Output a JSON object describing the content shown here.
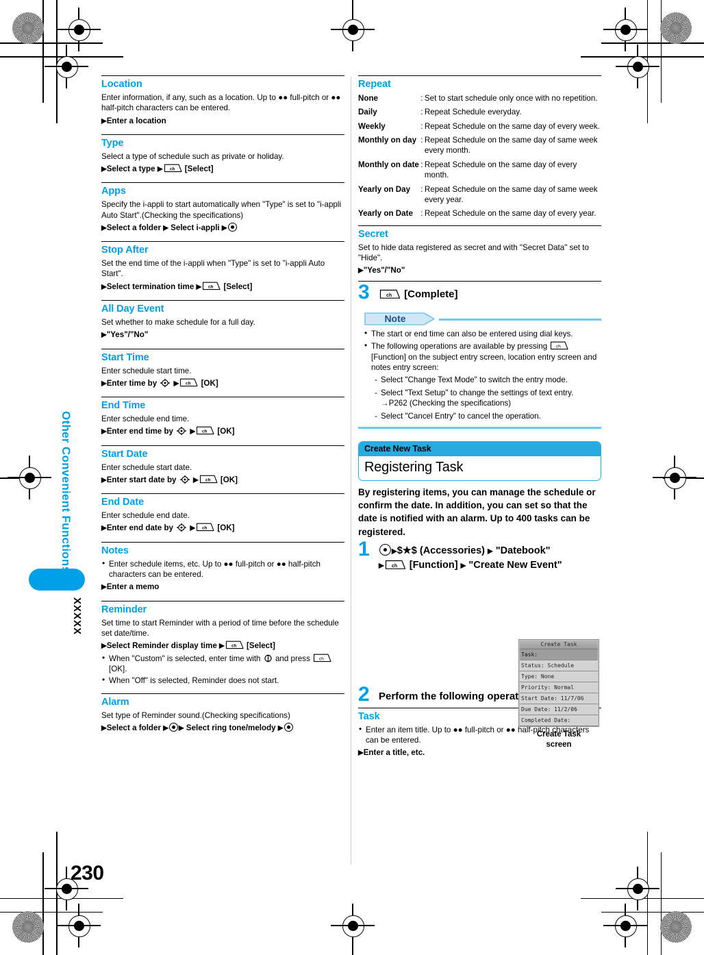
{
  "page": {
    "number": "230",
    "side_title": "Other Convenient Functions",
    "side_marker": "XXXXX"
  },
  "left_column": {
    "sections": [
      {
        "heading": "Location",
        "body": "Enter information, if any, such as a location. Up to ●● full-pitch or ●● half-pitch characters can be entered.",
        "operation": "Enter a location"
      },
      {
        "heading": "Type",
        "body": "Select a type of schedule such as private or holiday.",
        "operation": "Select a type",
        "operation_tail": "[Select]"
      },
      {
        "heading": "Apps",
        "body": "Specify the i-appli to start automatically when \"Type\" is set to \"i-appli Auto Start\".(Checking the specifications)",
        "operation": "Select a folder",
        "operation_mid": "Select i-appli"
      },
      {
        "heading": "Stop After",
        "body": "Set the end time of the i-appli when \"Type\" is set to \"i-appli Auto Start\".",
        "operation": "Select termination time",
        "operation_tail": "[Select]"
      },
      {
        "heading": "All Day Event",
        "body": "Set whether to make schedule for a full day.",
        "operation": "\"Yes\"/\"No\""
      },
      {
        "heading": "Start Time",
        "body": "Enter schedule start time.",
        "operation": "Enter time by",
        "operation_tail": "[OK]"
      },
      {
        "heading": "End Time",
        "body": "Enter schedule end time.",
        "operation": "Enter end time by",
        "operation_tail": "[OK]"
      },
      {
        "heading": "Start Date",
        "body": "Enter schedule start date.",
        "operation": "Enter start date by",
        "operation_tail": "[OK]"
      },
      {
        "heading": "End Date",
        "body": "Enter schedule end date.",
        "operation": "Enter end date by",
        "operation_tail": "[OK]"
      },
      {
        "heading": "Notes",
        "bullet": "Enter schedule items, etc. Up to ●● full-pitch or ●● half-pitch characters can be entered.",
        "operation": "Enter a memo"
      },
      {
        "heading": "Reminder",
        "body": "Set time to start Reminder with a period of time before the schedule set date/time.",
        "operation": "Select Reminder display time",
        "operation_tail": "[Select]",
        "bullet1_a": "When \"Custom\" is selected, enter time with",
        "bullet1_b": "and press",
        "bullet1_c": "[OK].",
        "bullet2": "When \"Off\" is selected, Reminder does not start."
      },
      {
        "heading": "Alarm",
        "body": "Set type of Reminder sound.(Checking specifications)",
        "operation": "Select a folder",
        "operation_mid": "Select ring tone/melody"
      }
    ]
  },
  "right_column": {
    "repeat": {
      "heading": "Repeat",
      "rows": [
        {
          "term": "None",
          "colon": ":",
          "desc": "Set to start schedule only once with no repetition."
        },
        {
          "term": "Daily",
          "colon": ":",
          "desc": "Repeat Schedule everyday."
        },
        {
          "term": "Weekly",
          "colon": ":",
          "desc": "Repeat Schedule on the same day of every week."
        },
        {
          "term": "Monthly on day",
          "colon": ":",
          "desc": "Repeat Schedule on the same day of same week every month."
        },
        {
          "term": "Monthly on date",
          "colon": ":",
          "desc": "Repeat Schedule on the same day of every month."
        },
        {
          "term": "Yearly on Day",
          "colon": ":",
          "desc": "Repeat Schedule on the same day of same week every year."
        },
        {
          "term": "Yearly on Date",
          "colon": ":",
          "desc": "Repeat Schedule on the same day of every year."
        }
      ]
    },
    "secret": {
      "heading": "Secret",
      "body": "Set to hide data registered as secret and with \"Secret Data\" set to \"Hide\".",
      "operation": "\"Yes\"/\"No\""
    },
    "step3": {
      "number": "3",
      "text": "[Complete]"
    },
    "note": {
      "badge": "Note",
      "bullets": [
        "The start or end time can also be entered using dial keys."
      ],
      "bullet2_a": "The following operations are available by pressing",
      "bullet2_b": "[Function] on the subject entry screen, location entry screen and notes entry screen:",
      "dashes": [
        "Select \"Change Text Mode\" to switch the entry mode.",
        "Select \"Text Setup\" to change the settings of text entry. →P262 (Checking the specifications)",
        "Select \"Cancel Entry\" to cancel the operation."
      ]
    },
    "panel": {
      "eyebrow": "Create New Task",
      "title": "Registering Task"
    },
    "intro": "By registering items, you can manage the schedule or confirm the date. In addition, you can set so that the date is notified with an alarm. Up to 400 tasks can be registered.",
    "step1": {
      "number": "1",
      "line1_a": "$★$ (Accessories)",
      "line1_b": "\"Datebook\"",
      "line2_a": "[Function]",
      "line2_b": "\"Create New Event\""
    },
    "step2": {
      "number": "2",
      "text": "Perform the following operations"
    },
    "task": {
      "heading": "Task",
      "bullet": "Enter an item title. Up to ●● full-pitch or ●● half-pitch characters can be entered.",
      "operation": "Enter a title, etc."
    },
    "phone_screen": {
      "title": "Create Task",
      "rows": [
        "Task:",
        "Status: Schedule",
        "Type: None",
        "Priority: Normal",
        "Start Date: 11/7/06",
        "Due Date: 11/2/06",
        "Completed Date:"
      ],
      "caption_line1": "Create Task",
      "caption_line2": "screen"
    }
  },
  "icons": {
    "ch_key": "ch",
    "arrow": "▶"
  },
  "colors": {
    "heading_cyan": "#00a0e9",
    "panel_cyan": "#29abe2",
    "note_rule": "#66ccf0",
    "note_text": "#1f4e8c"
  }
}
